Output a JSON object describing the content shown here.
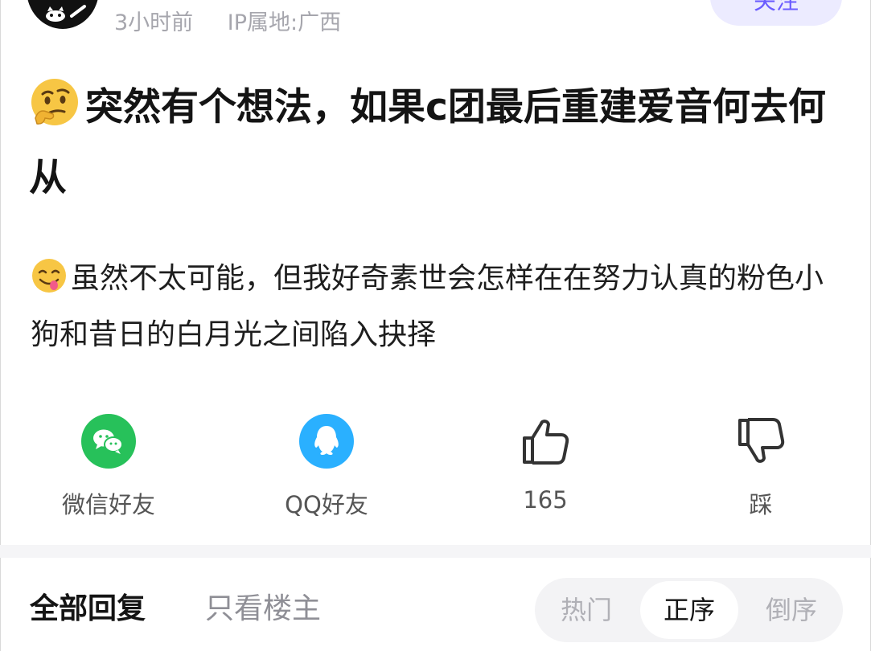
{
  "post": {
    "time": "3小时前",
    "ip_location": "IP属地:广西",
    "follow_label": "关注",
    "title": "突然有个想法，如果c团最后重建爱音何去何从",
    "content": "虽然不太可能，但我好奇素世会怎样在在努力认真的粉色小狗和昔日的白月光之间陷入抉择"
  },
  "actions": {
    "wechat_label": "微信好友",
    "qq_label": "QQ好友",
    "like_count": "165",
    "dislike_label": "踩"
  },
  "replies": {
    "tab_all": "全部回复",
    "tab_op_only": "只看楼主",
    "sort_hot": "热门",
    "sort_asc": "正序",
    "sort_desc": "倒序"
  },
  "colors": {
    "wechat": "#27c15a",
    "qq": "#2ab0ff",
    "accent": "#6b5cff"
  }
}
